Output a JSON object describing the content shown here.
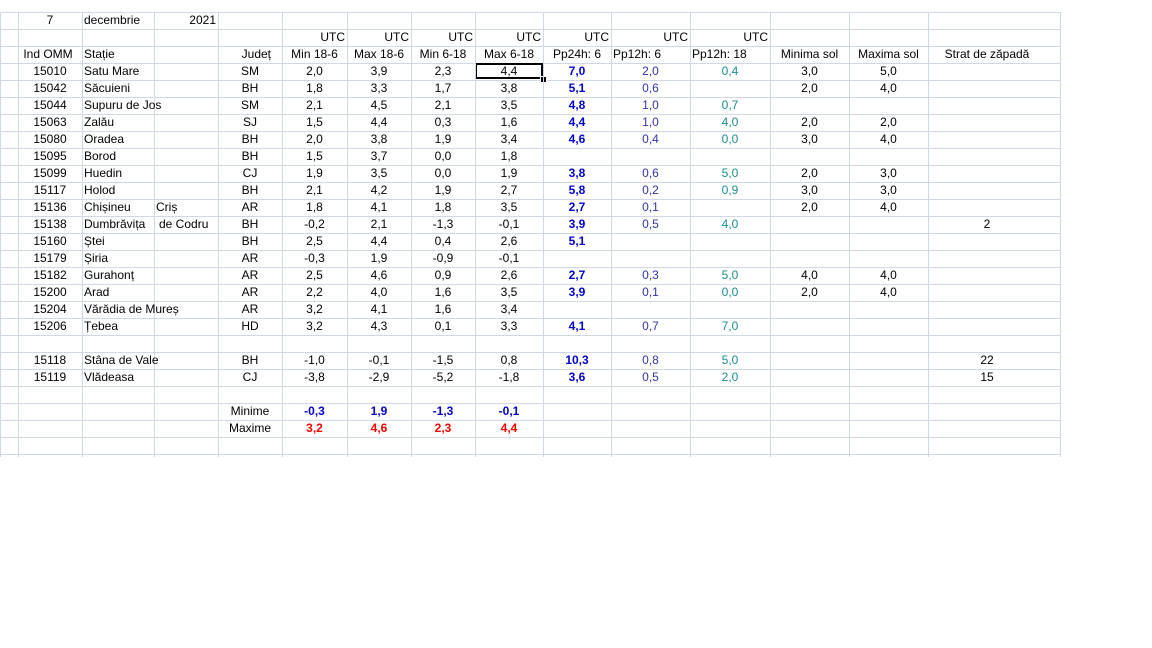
{
  "colors": {
    "blue_bold": "#0000cc",
    "blue_light": "#3333aa",
    "teal": "#1a8c8c",
    "red": "#ff0000",
    "grid": "#d0d7e5"
  },
  "title_row": {
    "day": "7",
    "month": "decembrie",
    "year": "2021"
  },
  "utc_row": [
    "UTC",
    "UTC",
    "UTC",
    "UTC",
    "UTC",
    "UTC",
    "UTC"
  ],
  "headers": {
    "ind": "Ind OMM",
    "statie": "Stație",
    "judet": "Județ",
    "min186": "Min 18-6",
    "max186": "Max 18-6",
    "min618": "Min 6-18",
    "max618": "Max 6-18",
    "pp24": "Pp24h: 6",
    "pp12a": "Pp12h: 6",
    "pp12b": "Pp12h: 18",
    "minsol": "Minima sol",
    "maxsol": "Maxima sol",
    "zapada": "Strat de zăpadă"
  },
  "rows": [
    {
      "ind": "15010",
      "statie": "Satu Mare",
      "statie2": "",
      "judet": "SM",
      "min186": "2,0",
      "max186": "3,9",
      "min618": "2,3",
      "max618": "4,4",
      "pp24": "7,0",
      "pp12a": "2,0",
      "pp12b": "0,4",
      "minsol": "3,0",
      "maxsol": "5,0",
      "zapada": ""
    },
    {
      "ind": "15042",
      "statie": "Săcuieni",
      "statie2": "",
      "judet": "BH",
      "min186": "1,8",
      "max186": "3,3",
      "min618": "1,7",
      "max618": "3,8",
      "pp24": "5,1",
      "pp12a": "0,6",
      "pp12b": "",
      "minsol": "2,0",
      "maxsol": "4,0",
      "zapada": ""
    },
    {
      "ind": "15044",
      "statie": "Supuru de Jos",
      "statie2": "",
      "judet": "SM",
      "min186": "2,1",
      "max186": "4,5",
      "min618": "2,1",
      "max618": "3,5",
      "pp24": "4,8",
      "pp12a": "1,0",
      "pp12b": "0,7",
      "minsol": "",
      "maxsol": "",
      "zapada": ""
    },
    {
      "ind": "15063",
      "statie": "Zalău",
      "statie2": "",
      "judet": "SJ",
      "min186": "1,5",
      "max186": "4,4",
      "min618": "0,3",
      "max618": "1,6",
      "pp24": "4,4",
      "pp12a": "1,0",
      "pp12b": "4,0",
      "minsol": "2,0",
      "maxsol": "2,0",
      "zapada": ""
    },
    {
      "ind": "15080",
      "statie": "Oradea",
      "statie2": "",
      "judet": "BH",
      "min186": "2,0",
      "max186": "3,8",
      "min618": "1,9",
      "max618": "3,4",
      "pp24": "4,6",
      "pp12a": "0,4",
      "pp12b": "0,0",
      "minsol": "3,0",
      "maxsol": "4,0",
      "zapada": ""
    },
    {
      "ind": "15095",
      "statie": "Borod",
      "statie2": "",
      "judet": "BH",
      "min186": "1,5",
      "max186": "3,7",
      "min618": "0,0",
      "max618": "1,8",
      "pp24": "",
      "pp12a": "",
      "pp12b": "",
      "minsol": "",
      "maxsol": "",
      "zapada": ""
    },
    {
      "ind": "15099",
      "statie": "Huedin",
      "statie2": "",
      "judet": "CJ",
      "min186": "1,9",
      "max186": "3,5",
      "min618": "0,0",
      "max618": "1,9",
      "pp24": "3,8",
      "pp12a": "0,6",
      "pp12b": "5,0",
      "minsol": "2,0",
      "maxsol": "3,0",
      "zapada": ""
    },
    {
      "ind": "15117",
      "statie": "Holod",
      "statie2": "",
      "judet": "BH",
      "min186": "2,1",
      "max186": "4,2",
      "min618": "1,9",
      "max618": "2,7",
      "pp24": "5,8",
      "pp12a": "0,2",
      "pp12b": "0,9",
      "minsol": "3,0",
      "maxsol": "3,0",
      "zapada": ""
    },
    {
      "ind": "15136",
      "statie": "Chișineu",
      "statie2": "Criș",
      "judet": "AR",
      "min186": "1,8",
      "max186": "4,1",
      "min618": "1,8",
      "max618": "3,5",
      "pp24": "2,7",
      "pp12a": "0,1",
      "pp12b": "",
      "minsol": "2,0",
      "maxsol": "4,0",
      "zapada": ""
    },
    {
      "ind": "15138",
      "statie": "Dumbrăvița",
      "statie2": "de Codru",
      "judet": "BH",
      "min186": "-0,2",
      "max186": "2,1",
      "min618": "-1,3",
      "max618": "-0,1",
      "pp24": "3,9",
      "pp12a": "0,5",
      "pp12b": "4,0",
      "minsol": "",
      "maxsol": "",
      "zapada": "2"
    },
    {
      "ind": "15160",
      "statie": "Ștei",
      "statie2": "",
      "judet": "BH",
      "min186": "2,5",
      "max186": "4,4",
      "min618": "0,4",
      "max618": "2,6",
      "pp24": "5,1",
      "pp12a": "",
      "pp12b": "",
      "minsol": "",
      "maxsol": "",
      "zapada": ""
    },
    {
      "ind": "15179",
      "statie": "Șiria",
      "statie2": "",
      "judet": "AR",
      "min186": "-0,3",
      "max186": "1,9",
      "min618": "-0,9",
      "max618": "-0,1",
      "pp24": "",
      "pp12a": "",
      "pp12b": "",
      "minsol": "",
      "maxsol": "",
      "zapada": ""
    },
    {
      "ind": "15182",
      "statie": "Gurahonț",
      "statie2": "",
      "judet": "AR",
      "min186": "2,5",
      "max186": "4,6",
      "min618": "0,9",
      "max618": "2,6",
      "pp24": "2,7",
      "pp12a": "0,3",
      "pp12b": "5,0",
      "minsol": "4,0",
      "maxsol": "4,0",
      "zapada": ""
    },
    {
      "ind": "15200",
      "statie": "Arad",
      "statie2": "",
      "judet": "AR",
      "min186": "2,2",
      "max186": "4,0",
      "min618": "1,6",
      "max618": "3,5",
      "pp24": "3,9",
      "pp12a": "0,1",
      "pp12b": "0,0",
      "minsol": "2,0",
      "maxsol": "4,0",
      "zapada": ""
    },
    {
      "ind": "15204",
      "statie": "Vărădia de Mureș",
      "statie2": "",
      "judet": "AR",
      "min186": "3,2",
      "max186": "4,1",
      "min618": "1,6",
      "max618": "3,4",
      "pp24": "",
      "pp12a": "",
      "pp12b": "",
      "minsol": "",
      "maxsol": "",
      "zapada": ""
    },
    {
      "ind": "15206",
      "statie": "Țebea",
      "statie2": "",
      "judet": "HD",
      "min186": "3,2",
      "max186": "4,3",
      "min618": "0,1",
      "max618": "3,3",
      "pp24": "4,1",
      "pp12a": "0,7",
      "pp12b": "7,0",
      "minsol": "",
      "maxsol": "",
      "zapada": ""
    }
  ],
  "rows_mountain": [
    {
      "ind": "15118",
      "statie": "Stâna de Vale",
      "statie2": "",
      "judet": "BH",
      "min186": "-1,0",
      "max186": "-0,1",
      "min618": "-1,5",
      "max618": "0,8",
      "pp24": "10,3",
      "pp12a": "0,8",
      "pp12b": "5,0",
      "minsol": "",
      "maxsol": "",
      "zapada": "22"
    },
    {
      "ind": "15119",
      "statie": "Vlădeasa",
      "statie2": "",
      "judet": "CJ",
      "min186": "-3,8",
      "max186": "-2,9",
      "min618": "-5,2",
      "max618": "-1,8",
      "pp24": "3,6",
      "pp12a": "0,5",
      "pp12b": "2,0",
      "minsol": "",
      "maxsol": "",
      "zapada": "15"
    }
  ],
  "summary": {
    "minime_label": "Minime",
    "maxime_label": "Maxime",
    "minime": [
      "-0,3",
      "1,9",
      "-1,3",
      "-0,1"
    ],
    "maxime": [
      "3,2",
      "4,6",
      "2,3",
      "4,4"
    ]
  }
}
